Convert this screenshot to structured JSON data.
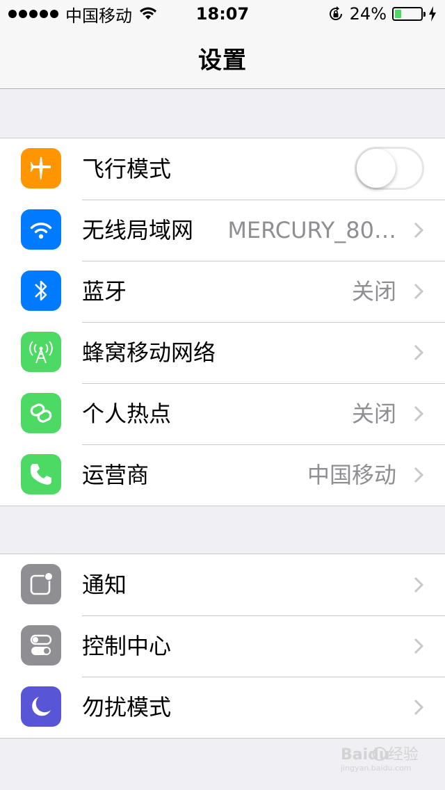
{
  "status_bar": {
    "carrier": "中国移动",
    "time": "18:07",
    "battery_percent_text": "24%",
    "battery_level": 0.24
  },
  "nav": {
    "title": "设置"
  },
  "colors": {
    "orange": "#ff9500",
    "blue": "#007aff",
    "green": "#4cd964",
    "gray": "#8e8e93",
    "purple": "#5856d6"
  },
  "group1": {
    "rows": [
      {
        "label": "飞行模式",
        "icon": "airplane-icon",
        "control": "toggle",
        "toggle_on": false
      },
      {
        "label": "无线局域网",
        "icon": "wifi-icon",
        "value": "MERCURY_80…"
      },
      {
        "label": "蓝牙",
        "icon": "bluetooth-icon",
        "value": "关闭"
      },
      {
        "label": "蜂窝移动网络",
        "icon": "cellular-icon"
      },
      {
        "label": "个人热点",
        "icon": "hotspot-icon",
        "value": "关闭"
      },
      {
        "label": "运营商",
        "icon": "phone-icon",
        "value": "中国移动"
      }
    ]
  },
  "group2": {
    "rows": [
      {
        "label": "通知",
        "icon": "notifications-icon"
      },
      {
        "label": "控制中心",
        "icon": "control-center-icon"
      },
      {
        "label": "勿扰模式",
        "icon": "moon-icon"
      }
    ]
  },
  "watermark": {
    "brand": "Bai",
    "brand2": "du",
    "suffix": "经验",
    "url": "jingyan.baidu.com"
  }
}
